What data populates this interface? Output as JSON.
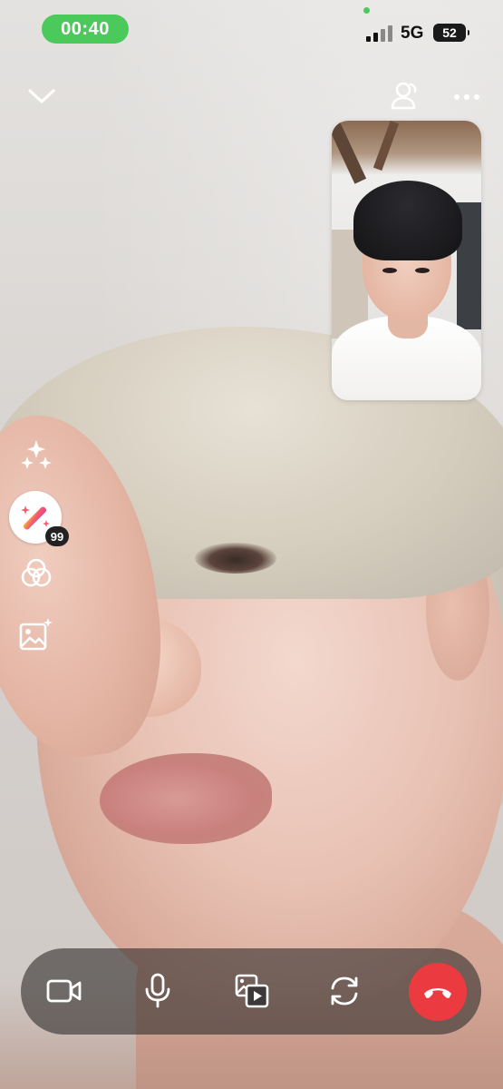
{
  "status_bar": {
    "time": "00:40",
    "network": "5G",
    "battery": "52",
    "colors": {
      "time_pill": "#4cc95b",
      "camera_dot": "#4cc95b"
    },
    "signal_bars_filled": 2,
    "signal_bars_total": 4
  },
  "top_controls": {
    "icons": [
      "chevron-down-icon",
      "participants-icon",
      "more-dots-icon"
    ]
  },
  "left_tools": {
    "icons": [
      "sparkles-icon",
      "magic-wand-icon",
      "filter-circles-icon",
      "image-sparkle-icon"
    ],
    "effects_badge": "99"
  },
  "bottom_bar": {
    "icons": [
      "video-camera-icon",
      "microphone-icon",
      "share-media-icon",
      "flip-camera-icon",
      "end-call-icon"
    ],
    "colors": {
      "end_call": "#ec3a41",
      "bar_background": "rgba(52,48,47,0.62)"
    }
  }
}
